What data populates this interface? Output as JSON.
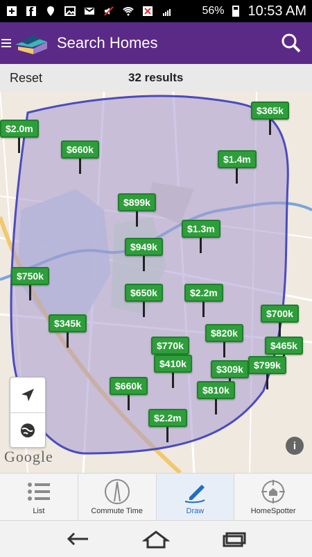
{
  "status_bar": {
    "battery": "56%",
    "time": "10:53 AM"
  },
  "app_bar": {
    "title": "Search Homes"
  },
  "results_bar": {
    "reset_label": "Reset",
    "results_text": "32 results"
  },
  "map": {
    "markers": [
      "$2.0m",
      "$660k",
      "$1.4m",
      "$365k",
      "$899k",
      "$1.3m",
      "$949k",
      "$750k",
      "$650k",
      "$2.2m",
      "$700k",
      "$345k",
      "$820k",
      "$770k",
      "$410k",
      "$465k",
      "$309k",
      "$799k",
      "$660k",
      "$810k",
      "$2.2m"
    ],
    "google_logo": "Google",
    "info_label": "i"
  },
  "tabs": [
    {
      "label": "List",
      "icon": "list-icon"
    },
    {
      "label": "Commute Time",
      "icon": "road-icon"
    },
    {
      "label": "Draw",
      "icon": "pen-icon",
      "active": true
    },
    {
      "label": "HomeSpotter",
      "icon": "homespotter-icon"
    }
  ],
  "nav": {
    "back_icon": "back-icon",
    "home_icon": "home-icon",
    "recent_icon": "recent-apps-icon"
  }
}
